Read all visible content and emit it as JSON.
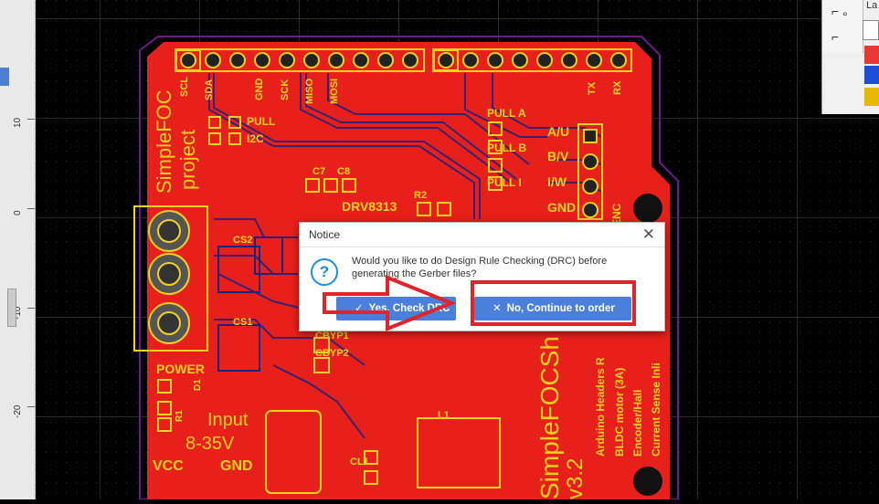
{
  "ruler": {
    "ticks": [
      "10",
      "0",
      "-10",
      "-20"
    ]
  },
  "pcb": {
    "header_labels": [
      "SCL",
      "SDA",
      "GND",
      "SCK",
      "MISO",
      "MOSI",
      "TX",
      "RX"
    ],
    "project_line1": "SimpleFOC",
    "project_line2": "project",
    "labels": {
      "pull": "PULL",
      "i2c": "I2C",
      "pull_a": "PULL A",
      "pull_b": "PULL B",
      "pull_i": "PULL I",
      "au": "A/U",
      "bv": "B/V",
      "iw": "I/W",
      "gnd": "GND",
      "enc": "ENC",
      "c7": "C7",
      "c8": "C8",
      "r2": "R2",
      "drv": "DRV8313",
      "cs2": "CS2",
      "cs1": "CS1",
      "cbyp1": "CBYP1",
      "cbyp2": "CBYP2",
      "power": "POWER",
      "d1": "D1",
      "r1": "R1",
      "input": "Input",
      "volts": "8-35V",
      "vcc": "VCC",
      "gnd2": "GND",
      "l1": "L1",
      "cl1": "CL1",
      "side1": "Arduino Headers R",
      "side2": "BLDC motor (3A)",
      "side3": "Encoder/Hall",
      "side4": "Current Sense Inli",
      "brand_big": "SimpleFOCSh",
      "brand_ver": "v3.2"
    }
  },
  "toolbar": {
    "layers_label": "La",
    "select_icon_label": "⌐",
    "swatch_colors": [
      "#ffffff",
      "#e53935",
      "#1e4fd8",
      "#e6b800"
    ]
  },
  "dialog": {
    "title": "Notice",
    "message": "Would you like to do Design Rule Checking (DRC) before generating the Gerber files?",
    "yes_label": "Yes, Check DRC",
    "no_label": "No, Continue to order",
    "close_glyph": "✕",
    "question_glyph": "?",
    "yes_glyph": "✓",
    "no_glyph": "✕"
  },
  "colors": {
    "board": "#e8201c",
    "silk": "#f2d21b",
    "trace": "#1a237e",
    "annotation_red": "#e1232a",
    "accent_blue": "#4a7fdc"
  }
}
